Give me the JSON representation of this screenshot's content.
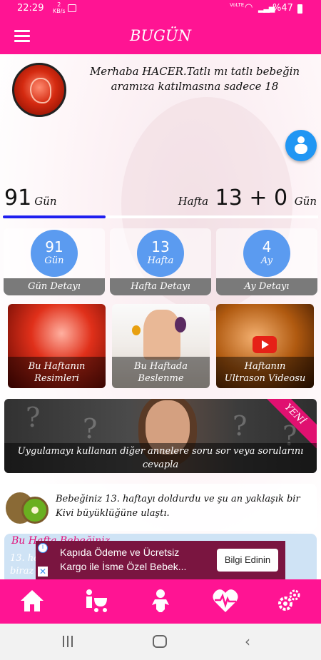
{
  "status_bar": {
    "time": "22:29",
    "data_speed_value": "2",
    "data_speed_unit": "KB/s",
    "network": "VoLTE",
    "battery": "%47",
    "icons": [
      "gallery-icon",
      "wifi-icon",
      "signal-icon",
      "battery-icon"
    ]
  },
  "app_bar": {
    "title": "BUGÜN"
  },
  "greeting": "Merhaba HACER.Tatlı mı tatlı bebeğin aramıza katılmasına sadece 18",
  "counters": {
    "days_value": "91",
    "days_unit": "Gün",
    "week_prefix": "Hafta",
    "week_value": "13 + 0",
    "week_suffix": "Gün",
    "progress_fraction": 0.325
  },
  "stat_cards": [
    {
      "value": "91",
      "unit": "Gün",
      "label": "Gün Detayı"
    },
    {
      "value": "13",
      "unit": "Hafta",
      "label": "Hafta Detayı"
    },
    {
      "value": "4",
      "unit": "Ay",
      "label": "Ay Detayı"
    }
  ],
  "media_cards": [
    {
      "line1": "Bu Haftanın",
      "line2": "Resimleri"
    },
    {
      "line1": "Bu Haftada",
      "line2": "Beslenme"
    },
    {
      "line1": "Haftanın",
      "line2": "Ultrason Videosu"
    }
  ],
  "ask_banner": {
    "ribbon": "YENİ",
    "caption": "Uygulamayı kullanan diğer annelere soru sor veya sorularını cevapla"
  },
  "size_card": {
    "text": "Bebeğiniz 13. haftayı doldurdu ve şu an yaklaşık bir Kivi büyüklüğüne ulaştı."
  },
  "info_card": {
    "title": "Bu Hafta Bebeğiniz",
    "body_line1": "13. ha",
    "body_line2": "biraz"
  },
  "ad": {
    "text": "Kapıda Ödeme ve Ücretsiz Kargo ile İsme Özel Bebek...",
    "cta": "Bilgi Edinin",
    "info_glyph": "i",
    "close_glyph": "✕"
  },
  "bottom_nav": [
    "home-icon",
    "stroller-icon",
    "baby-icon",
    "heartbeat-icon",
    "settings-icon"
  ],
  "colors": {
    "brand_pink": "#ff1493",
    "stat_circle": "#5b9bf0",
    "progress": "#1f1ff0",
    "fab": "#2196f3"
  }
}
